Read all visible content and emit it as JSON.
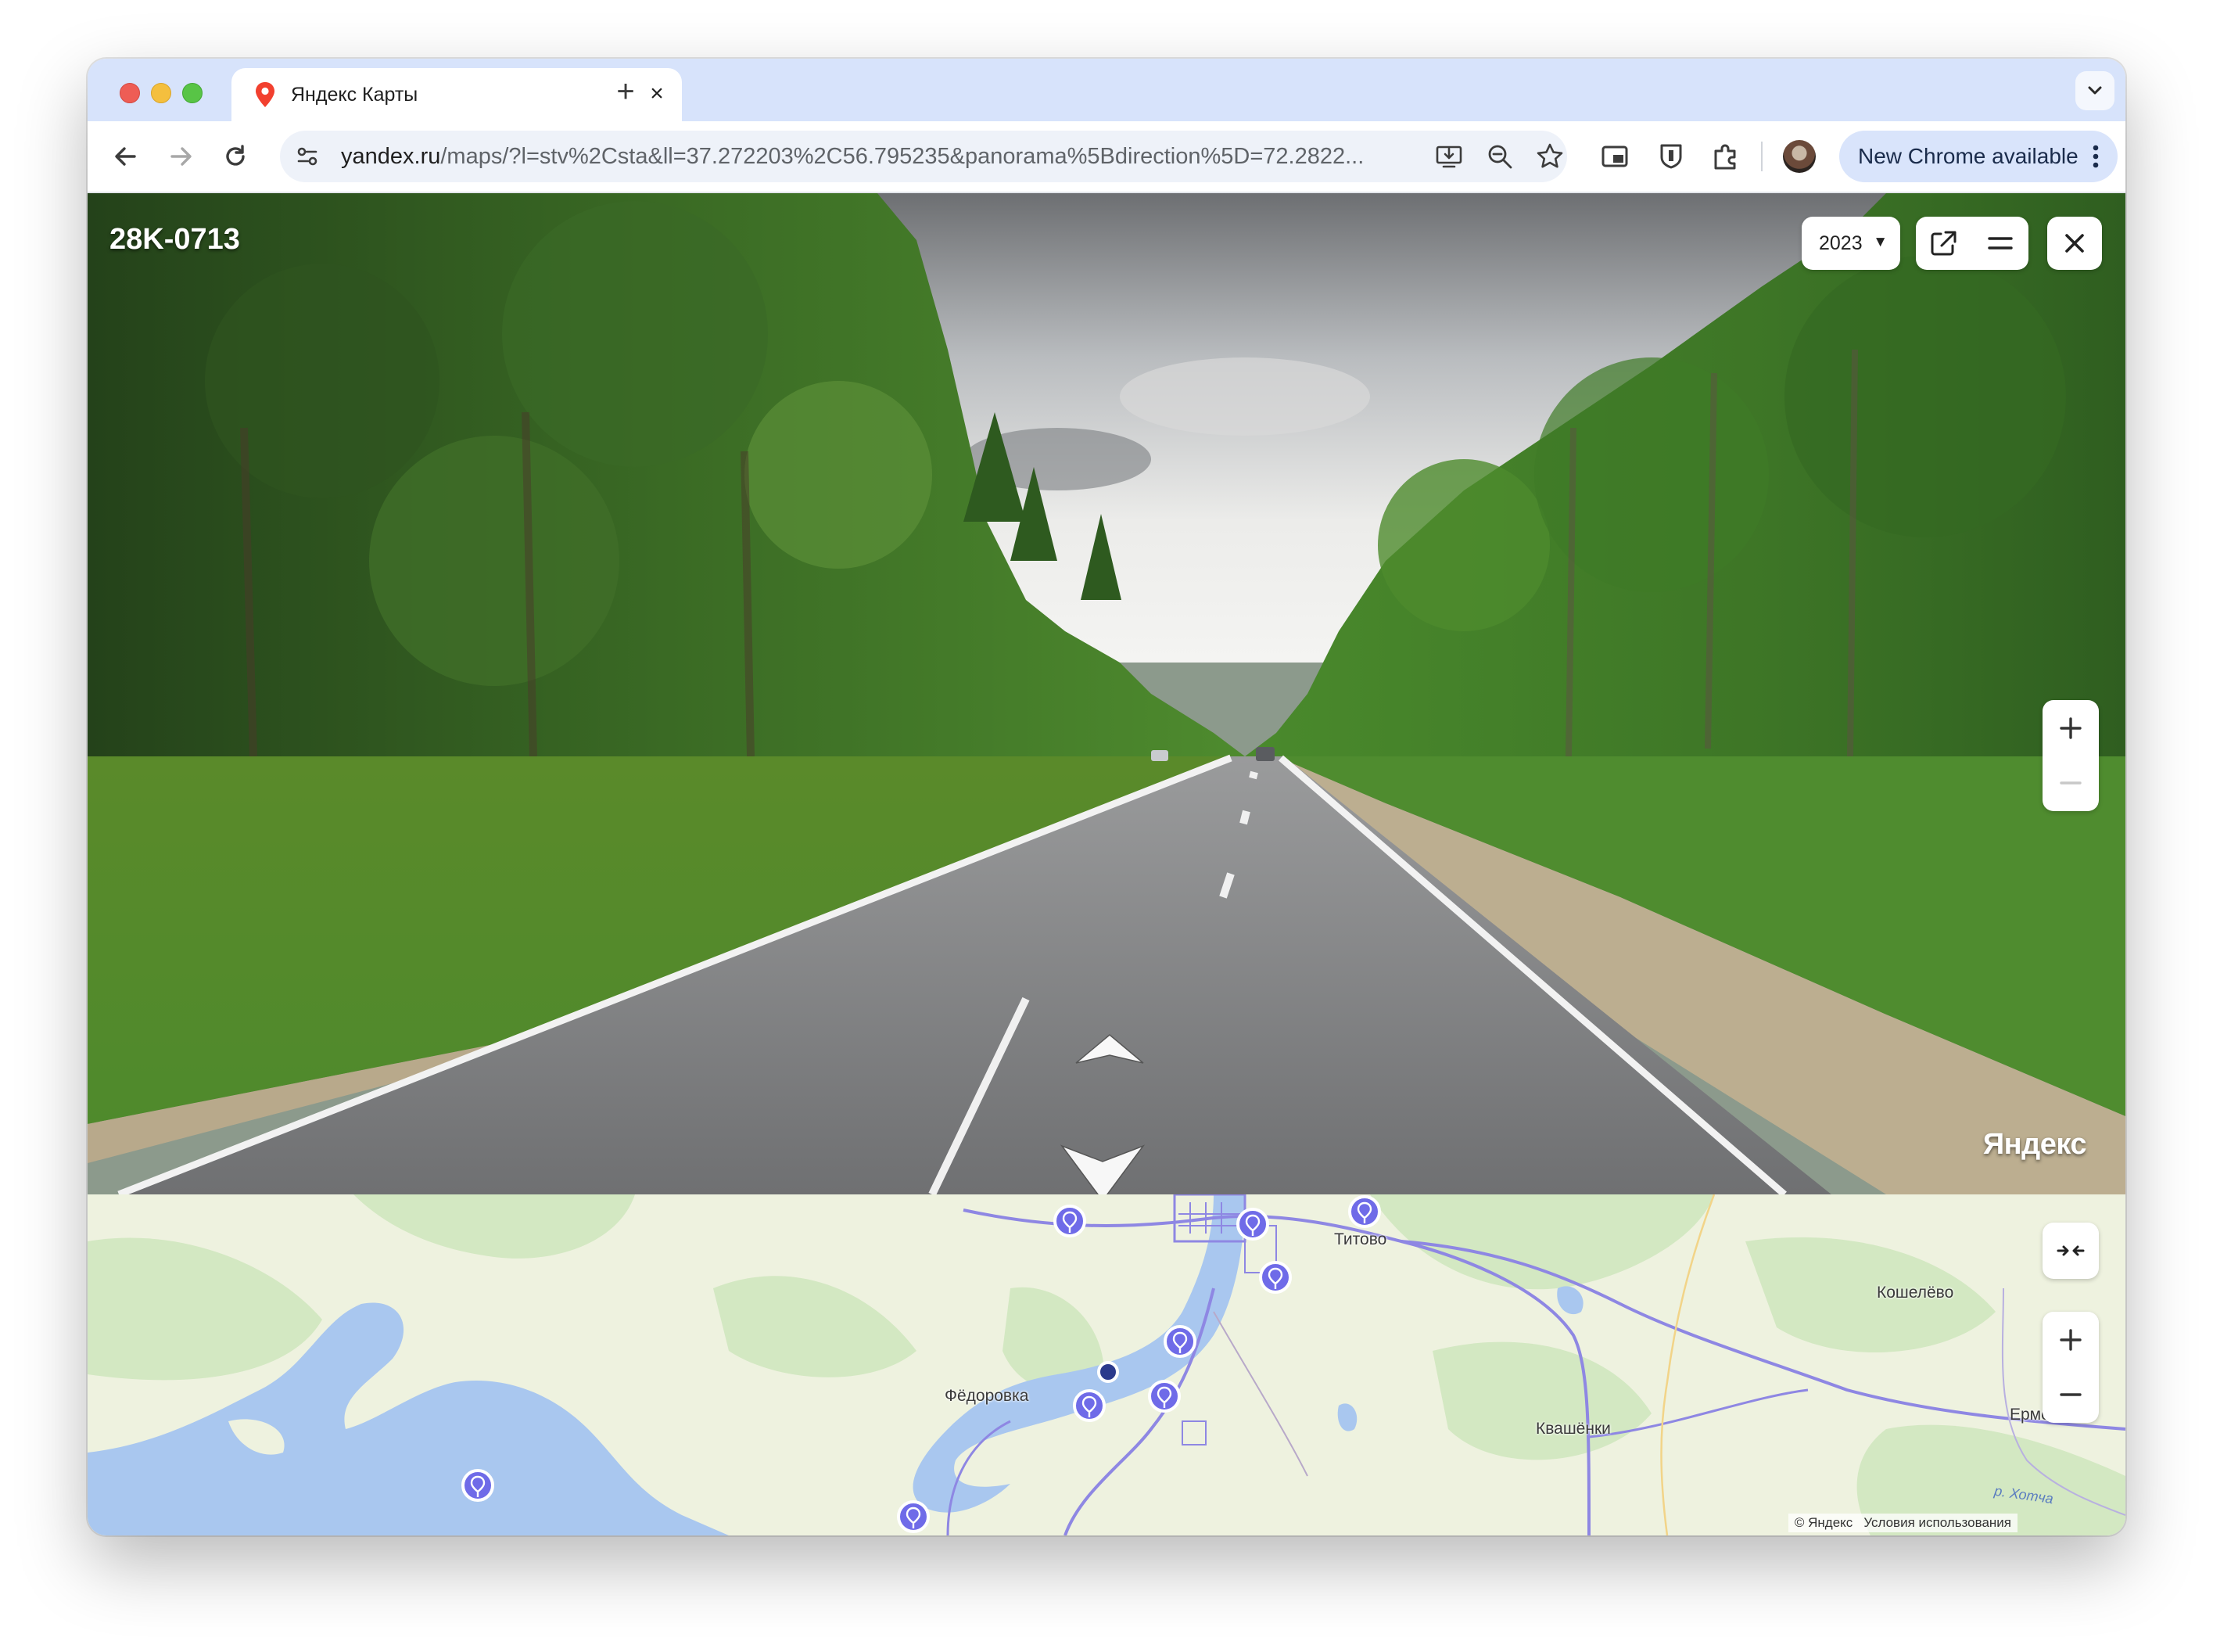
{
  "browser": {
    "tab": {
      "title": "Яндекс Карты",
      "close_icon": "×"
    },
    "new_tab_icon": "+",
    "url": {
      "host": "yandex.ru",
      "rest": "/maps/?l=stv%2Csta&ll=37.272203%2C56.795235&panorama%5Bdirection%5D=72.2822..."
    },
    "update_button": {
      "label": "New Chrome available"
    }
  },
  "panorama": {
    "road_id": "28K-0713",
    "year": "2023",
    "year_caret": "▼",
    "watermark": "Яндекс",
    "zoom_in_symbol": "+",
    "zoom_out_symbol": "−"
  },
  "minimap": {
    "places": [
      "Титово",
      "Кошелёво",
      "Фёдоровка",
      "Квашёнки",
      "Ермолино"
    ],
    "river": "р. Хотча",
    "copyright": "© Яндекс",
    "terms": "Условия использования"
  },
  "colors": {
    "tab_strip": "#d7e3fb",
    "omnibox": "#eef2f9",
    "map_water": "#a9c7ef",
    "map_forest": "#d3e8c2",
    "map_road": "#8e87e3",
    "pin": "#6f6be8"
  }
}
